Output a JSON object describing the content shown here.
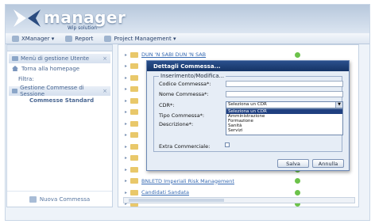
{
  "app": {
    "logo_title": "manager",
    "logo_subtitle": "Wip solution"
  },
  "menubar": [
    {
      "label": "XManager ▾"
    },
    {
      "label": "Report"
    },
    {
      "label": "Project Management ▾"
    }
  ],
  "sidebar": {
    "section_1": "Menù di gestione Utente",
    "home": "Torna alla homepage",
    "filtra": "Filtra:",
    "section_2": "Gestione Commesse di Sessione",
    "commesse": "Commesse Standard",
    "new_button": "Nuova Commessa"
  },
  "rows": [
    {
      "label": "DUN 'N SABI DUN 'N SAB"
    },
    {
      "label": ""
    },
    {
      "label": ""
    },
    {
      "label": ""
    },
    {
      "label": ""
    },
    {
      "label": ""
    },
    {
      "label": ""
    },
    {
      "label": ""
    },
    {
      "label": ""
    },
    {
      "label": ""
    },
    {
      "label": ""
    },
    {
      "label": "BNLETD Imperiali Risk Management"
    },
    {
      "label": "Candidati Sandata"
    },
    {
      "label": ""
    }
  ],
  "dialog": {
    "title": "Dettagli Commessa...",
    "legend": "Inserimento/Modifica...",
    "codice_label": "Codice Commessa*:",
    "nome_label": "Nome Commessa*:",
    "cdr_label": "CDR*:",
    "cdr_value": "Seleziona un CDR",
    "tipo_label": "Tipo Commessa*:",
    "descrizione_label": "Descrizione*:",
    "extra_label": "Extra Commerciale:",
    "dropdown_options": [
      "Seleziona un CDR",
      "Amministrazione",
      "Formazione",
      "Sanità",
      "Servizi"
    ],
    "save": "Salva",
    "cancel": "Annulla"
  },
  "colors": {
    "title_bar": "#1e3f78",
    "accent": "#3569b2",
    "ok": "#6cc24a"
  }
}
